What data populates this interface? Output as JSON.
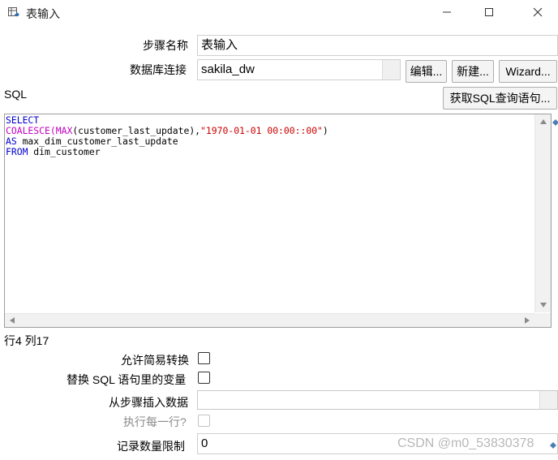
{
  "window": {
    "title": "表输入",
    "icon": "table-input-icon",
    "controls": [
      "minimize-icon",
      "maximize-icon",
      "close-icon"
    ]
  },
  "step_name": {
    "label": "步骤名称",
    "value": "表输入"
  },
  "connection": {
    "label": "数据库连接",
    "value": "sakila_dw",
    "edit_label": "编辑...",
    "new_label": "新建...",
    "wizard_label": "Wizard..."
  },
  "sql": {
    "label": "SQL",
    "get_sql_label": "获取SQL查询语句...",
    "lines": [
      [
        {
          "t": "SELECT",
          "c": "kw"
        }
      ],
      [
        {
          "t": "COALESCE(",
          "c": "fn"
        },
        {
          "t": "MAX",
          "c": "fn"
        },
        {
          "t": "(customer_last_update),",
          "c": ""
        },
        {
          "t": "\"1970-01-01 00:00::00\"",
          "c": "str"
        },
        {
          "t": ")",
          "c": ""
        }
      ],
      [
        {
          "t": "AS",
          "c": "kw"
        },
        {
          "t": " max_dim_customer_last_update",
          "c": ""
        }
      ],
      [
        {
          "t": "FROM",
          "c": "kw"
        },
        {
          "t": " dim_customer",
          "c": ""
        }
      ]
    ]
  },
  "cursor_position": "行4 列17",
  "options": {
    "lazy_conversion_label": "允许简易转换",
    "replace_variables_label": "替换 SQL 语句里的变量",
    "insert_from_step_label": "从步骤插入数据",
    "insert_from_step_value": "",
    "execute_each_row_label": "执行每一行?",
    "limit_label": "记录数量限制",
    "limit_value": "0"
  },
  "watermark": "CSDN @m0_53830378"
}
